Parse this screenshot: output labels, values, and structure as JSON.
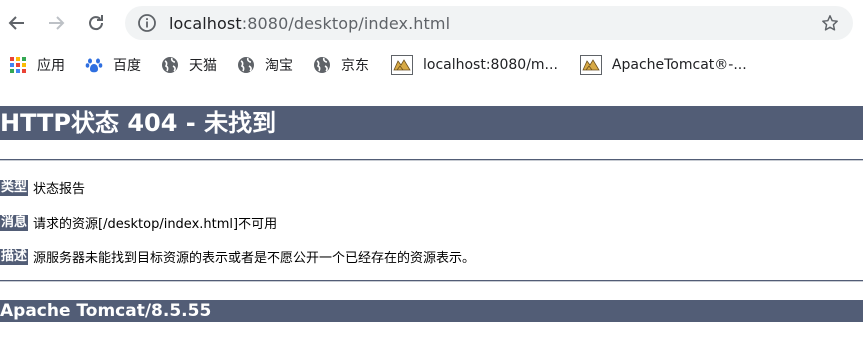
{
  "browser": {
    "url_host": "localhost",
    "url_rest": ":8080/desktop/index.html",
    "bookmarks": [
      {
        "label": "应用",
        "icon": "apps-grid-icon"
      },
      {
        "label": "百度",
        "icon": "baidu-paw-icon"
      },
      {
        "label": "天猫",
        "icon": "globe-icon"
      },
      {
        "label": "淘宝",
        "icon": "globe-icon"
      },
      {
        "label": "京东",
        "icon": "globe-icon"
      },
      {
        "label": "localhost:8080/m...",
        "icon": "tomcat-icon"
      },
      {
        "label": "ApacheTomcat®-...",
        "icon": "tomcat-icon"
      }
    ]
  },
  "page": {
    "title": "HTTP状态 404 - 未找到",
    "type_label": "类型",
    "type_value": "状态报告",
    "message_label": "消息",
    "message_value": "请求的资源[/desktop/index.html]不可用",
    "desc_label": "描述",
    "desc_value": "源服务器未能找到目标资源的表示或者是不愿公开一个已经存在的资源表示。",
    "footer": "Apache Tomcat/8.5.55"
  },
  "colors": {
    "header_bg": "#525d76",
    "header_text": "#ffffff",
    "omnibox_bg": "#f1f3f4"
  }
}
